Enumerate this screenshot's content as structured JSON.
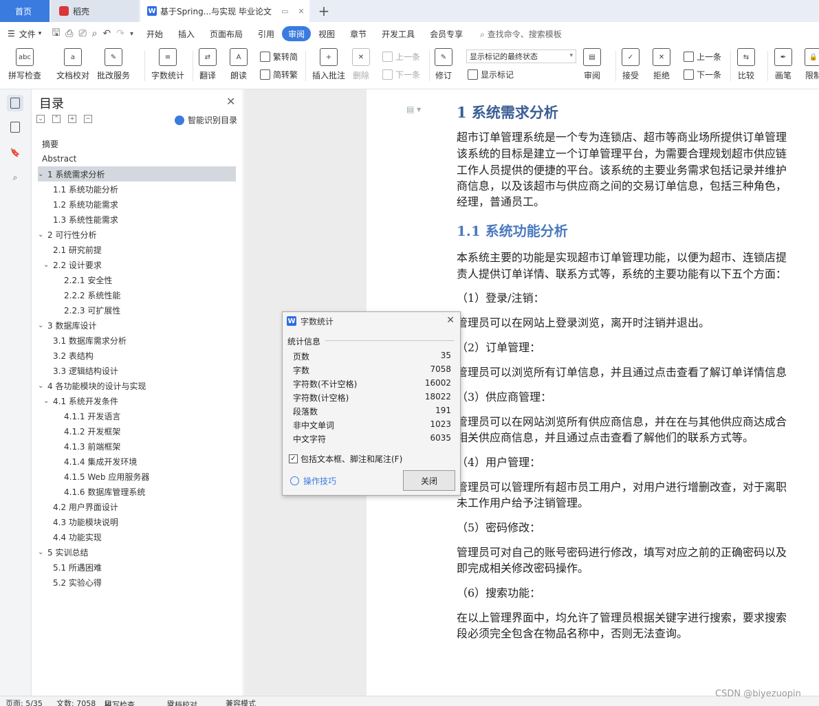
{
  "tabs": {
    "home": "首页",
    "daoke": "稻壳",
    "doc": "基于Spring...与实现 毕业论文",
    "plus": "+"
  },
  "menu": {
    "file": "文件",
    "items": [
      "开始",
      "插入",
      "页面布局",
      "引用",
      "审阅",
      "视图",
      "章节",
      "开发工具",
      "会员专享"
    ],
    "active": "审阅",
    "search": "查找命令、搜索模板"
  },
  "ribbon": {
    "spell": "拼写检查",
    "doc_check": "文档校对",
    "batch_service": "批改服务",
    "word_count": "字数统计",
    "translate": "翻译",
    "read": "朗读",
    "trad": "繁转简",
    "simp": "简转繁",
    "insert_comment": "插入批注",
    "delete": "删除",
    "prev": "上一条",
    "next": "下一条",
    "revise": "修订",
    "markup_select": "显示标记的最终状态",
    "show_markup": "显示标记",
    "review": "审阅",
    "accept": "接受",
    "reject": "拒绝",
    "prev2": "上一条",
    "next2": "下一条",
    "compare": "比较",
    "pen": "画笔",
    "limit": "限制"
  },
  "toc": {
    "title": "目录",
    "ai_label": "智能识别目录",
    "items": [
      {
        "text": "摘要",
        "level": 0,
        "chev": ""
      },
      {
        "text": "Abstract",
        "level": 0,
        "chev": ""
      },
      {
        "text": "1 系统需求分析",
        "level": 0,
        "chev": "v",
        "selected": true
      },
      {
        "text": "1.1 系统功能分析",
        "level": 1,
        "chev": ""
      },
      {
        "text": "1.2 系统功能需求",
        "level": 1,
        "chev": ""
      },
      {
        "text": "1.3 系统性能需求",
        "level": 1,
        "chev": ""
      },
      {
        "text": "2 可行性分析",
        "level": 0,
        "chev": "v"
      },
      {
        "text": "2.1 研究前提",
        "level": 1,
        "chev": ""
      },
      {
        "text": "2.2 设计要求",
        "level": 1,
        "chev": "v"
      },
      {
        "text": "2.2.1 安全性",
        "level": 2,
        "chev": ""
      },
      {
        "text": "2.2.2 系统性能",
        "level": 2,
        "chev": ""
      },
      {
        "text": "2.2.3 可扩展性",
        "level": 2,
        "chev": ""
      },
      {
        "text": "3 数据库设计",
        "level": 0,
        "chev": "v"
      },
      {
        "text": "3.1 数据库需求分析",
        "level": 1,
        "chev": ""
      },
      {
        "text": "3.2 表结构",
        "level": 1,
        "chev": ""
      },
      {
        "text": "3.3 逻辑结构设计",
        "level": 1,
        "chev": ""
      },
      {
        "text": "4 各功能模块的设计与实现",
        "level": 0,
        "chev": "v"
      },
      {
        "text": "4.1 系统开发条件",
        "level": 1,
        "chev": "v"
      },
      {
        "text": "4.1.1 开发语言",
        "level": 2,
        "chev": ""
      },
      {
        "text": "4.1.2 开发框架",
        "level": 2,
        "chev": ""
      },
      {
        "text": "4.1.3 前端框架",
        "level": 2,
        "chev": ""
      },
      {
        "text": "4.1.4 集成开发环境",
        "level": 2,
        "chev": ""
      },
      {
        "text": "4.1.5 Web 应用服务器",
        "level": 2,
        "chev": ""
      },
      {
        "text": "4.1.6 数据库管理系统",
        "level": 2,
        "chev": ""
      },
      {
        "text": "4.2 用户界面设计",
        "level": 1,
        "chev": ""
      },
      {
        "text": "4.3 功能模块说明",
        "level": 1,
        "chev": ""
      },
      {
        "text": "4.4 功能实现",
        "level": 1,
        "chev": ""
      },
      {
        "text": "5 实训总结",
        "level": 0,
        "chev": "v"
      },
      {
        "text": "5.1 所遇困难",
        "level": 1,
        "chev": ""
      },
      {
        "text": "5.2 实验心得",
        "level": 1,
        "chev": ""
      }
    ]
  },
  "document": {
    "h1": "1 系统需求分析",
    "h2": "1.1 系统功能分析",
    "lines": [
      "超市订单管理系统是一个专为连锁店、超市等商业场所提供订单管理",
      "该系统的目标是建立一个订单管理平台，为需要合理规划超市供应链",
      "工作人员提供的便捷的平台。该系统的主要业务需求包括记录并维护",
      "商信息，以及该超市与供应商之间的交易订单信息，包括三种角色，",
      "经理，普通员工。",
      "本系统主要的功能是实现超市订单管理功能，以便为超市、连锁店提",
      "责人提供订单详情、联系方式等，系统的主要功能有以下五个方面：",
      "（1）登录/注销：",
      "管理员可以在网站上登录浏览，离开时注销并退出。",
      "（2）订单管理：",
      "管理员可以浏览所有订单信息，并且通过点击查看了解订单详情信息",
      "（3）供应商管理：",
      "管理员可以在网站浏览所有供应商信息，并在在与其他供应商达成合",
      "相关供应商信息，并且通过点击查看了解他们的联系方式等。",
      "（4）用户管理：",
      "管理员可以管理所有超市员工用户，对用户进行增删改查，对于离职",
      "未工作用户给予注销管理。",
      "（5）密码修改：",
      "管理员可对自己的账号密码进行修改，填写对应之前的正确密码以及",
      "即完成相关修改密码操作。",
      "（6）搜索功能：",
      "在以上管理界面中，均允许了管理员根据关键字进行搜索，要求搜索",
      "段必须完全包含在物品名称中，否则无法查询。"
    ]
  },
  "dialog": {
    "title": "字数统计",
    "group": "统计信息",
    "stats": [
      {
        "label": "页数",
        "value": "35"
      },
      {
        "label": "字数",
        "value": "7058"
      },
      {
        "label": "字符数(不计空格)",
        "value": "16002"
      },
      {
        "label": "字符数(计空格)",
        "value": "18022"
      },
      {
        "label": "段落数",
        "value": "191"
      },
      {
        "label": "非中文单词",
        "value": "1023"
      },
      {
        "label": "中文字符",
        "value": "6035"
      }
    ],
    "checkbox_label": "包括文本框、脚注和尾注(F)",
    "checkbox_checked": true,
    "tips": "操作技巧",
    "close": "关闭"
  },
  "status": {
    "page": "页面: 5/35",
    "words": "文数: 7058",
    "spell": "拼写检查",
    "doc_check": "文档校对",
    "mode": "兼容模式"
  },
  "watermark": "CSDN @biyezuopin"
}
